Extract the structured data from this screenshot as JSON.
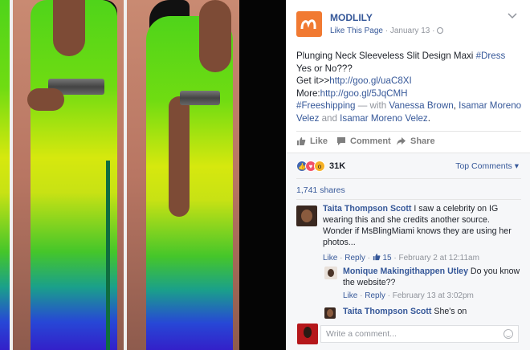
{
  "post": {
    "page_name": "MODLILY",
    "like_page": "Like This Page",
    "date": " · January 13 · ",
    "globe_icon": "globe-icon",
    "line1": "Plunging Neck Sleeveless Slit Design Maxi ",
    "hashtag_dress": "#Dress",
    "line2": "Yes or No???",
    "line3_prefix": "Get it>>",
    "link1": "http://goo.gl/uaC8XI",
    "line4_prefix": "More:",
    "link2": "http://goo.gl/5JqCMH",
    "hashtag_ship": "#Freeshipping",
    "with_text": " — with ",
    "tag1": "Vanessa Brown",
    "comma": ", ",
    "tag2": "Isamar Moreno Velez",
    "and_text": " and ",
    "tag3": "Isamar Moreno Velez",
    "period": "."
  },
  "actions": {
    "like": "Like",
    "comment": "Comment",
    "share": "Share"
  },
  "reactions": {
    "count": "31K",
    "top_comments": "Top Comments ▾",
    "shares": "1,741 shares"
  },
  "comments": [
    {
      "author": "Taita Thompson Scott",
      "text": " I saw a celebrity on IG wearing this and she credits another source. Wonder if MsBlingMiami knows they are using her photos...",
      "like": "Like",
      "reply": "Reply",
      "likes": "15",
      "time": "February 2 at 12:11am"
    },
    {
      "author": "Monique Makingithappen Utley",
      "text": " Do you know the website??",
      "like": "Like",
      "reply": "Reply",
      "time": "February 13 at 3:02pm"
    },
    {
      "author": "Taita Thompson Scott",
      "text": " She's on"
    }
  ],
  "composer": {
    "placeholder": "Write a comment..."
  },
  "colors": {
    "link": "#365899",
    "brand_orange": "#f17a32"
  }
}
